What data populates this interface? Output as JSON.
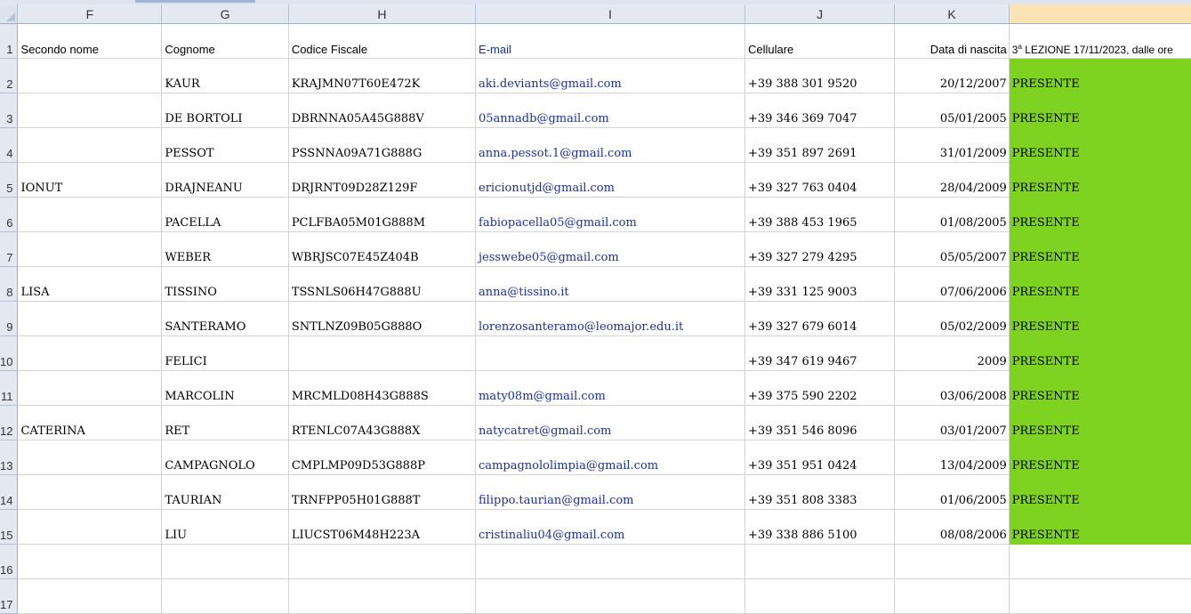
{
  "columns": [
    "F",
    "G",
    "H",
    "I",
    "J",
    "K",
    ""
  ],
  "rows": [
    {
      "num": "1",
      "nome": "Secondo nome",
      "cognome": "Cognome",
      "cf": "Codice Fiscale",
      "email": "E-mail",
      "cell": "Cellulare",
      "data": "Data di nascita",
      "presenza": ""
    },
    {
      "num": "2",
      "nome": "",
      "cognome": "KAUR",
      "cf": "KRAJMN07T60E472K",
      "email": "aki.deviants@gmail.com",
      "cell": "+39 388 301 9520",
      "data": "20/12/2007",
      "presenza": "PRESENTE"
    },
    {
      "num": "3",
      "nome": "",
      "cognome": "DE BORTOLI",
      "cf": "DBRNNA05A45G888V",
      "email": "05annadb@gmail.com",
      "cell": "+39 346 369 7047",
      "data": "05/01/2005",
      "presenza": "PRESENTE"
    },
    {
      "num": "4",
      "nome": "",
      "cognome": "PESSOT",
      "cf": "PSSNNA09A71G888G",
      "email": "anna.pessot.1@gmail.com",
      "cell": "+39 351 897 2691",
      "data": "31/01/2009",
      "presenza": "PRESENTE"
    },
    {
      "num": "5",
      "nome": "IONUT",
      "cognome": "DRAJNEANU",
      "cf": "DRJRNT09D28Z129F",
      "email": "ericionutjd@gmail.com",
      "cell": "+39 327 763 0404",
      "data": "28/04/2009",
      "presenza": "PRESENTE"
    },
    {
      "num": "6",
      "nome": "",
      "cognome": "PACELLA",
      "cf": "PCLFBA05M01G888M",
      "email": "fabiopacella05@gmail.com",
      "cell": "+39 388 453 1965",
      "data": "01/08/2005",
      "presenza": "PRESENTE"
    },
    {
      "num": "7",
      "nome": "",
      "cognome": "WEBER",
      "cf": "WBRJSC07E45Z404B",
      "email": "jesswebe05@gmail.com",
      "cell": "+39 327 279 4295",
      "data": "05/05/2007",
      "presenza": "PRESENTE"
    },
    {
      "num": "8",
      "nome": "LISA",
      "cognome": "TISSINO",
      "cf": "TSSNLS06H47G888U",
      "email": "anna@tissino.it",
      "cell": "+39 331 125 9003",
      "data": "07/06/2006",
      "presenza": "PRESENTE"
    },
    {
      "num": "9",
      "nome": "",
      "cognome": "SANTERAMO",
      "cf": "SNTLNZ09B05G888O",
      "email": "lorenzosanteramo@leomajor.edu.it",
      "cell": "+39 327 679 6014",
      "data": "05/02/2009",
      "presenza": "PRESENTE"
    },
    {
      "num": "10",
      "nome": "",
      "cognome": "FELICI",
      "cf": "",
      "email": "",
      "cell": "+39 347 619 9467",
      "data": "2009",
      "presenza": "PRESENTE"
    },
    {
      "num": "11",
      "nome": "",
      "cognome": "MARCOLIN",
      "cf": "MRCMLD08H43G888S",
      "email": "maty08m@gmail.com",
      "cell": "+39 375 590 2202",
      "data": "03/06/2008",
      "presenza": "PRESENTE"
    },
    {
      "num": "12",
      "nome": "CATERINA",
      "cognome": "RET",
      "cf": "RTENLC07A43G888X",
      "email": "natycatret@gmail.com",
      "cell": "+39 351 546 8096",
      "data": "03/01/2007",
      "presenza": "PRESENTE"
    },
    {
      "num": "13",
      "nome": "",
      "cognome": "CAMPAGNOLO",
      "cf": "CMPLMP09D53G888P",
      "email": "campagnololimpia@gmail.com",
      "cell": "+39 351 951 0424",
      "data": "13/04/2009",
      "presenza": "PRESENTE"
    },
    {
      "num": "14",
      "nome": "",
      "cognome": "TAURIAN",
      "cf": "TRNFPP05H01G888T",
      "email": "filippo.taurian@gmail.com",
      "cell": "+39 351 808 3383",
      "data": "01/06/2005",
      "presenza": "PRESENTE"
    },
    {
      "num": "15",
      "nome": "",
      "cognome": "LIU",
      "cf": "LIUCST06M48H223A",
      "email": "cristinaliu04@gmail.com",
      "cell": "+39 338 886 5100",
      "data": "08/08/2006",
      "presenza": "PRESENTE"
    },
    {
      "num": "16",
      "nome": "",
      "cognome": "",
      "cf": "",
      "email": "",
      "cell": "",
      "data": "",
      "presenza": ""
    },
    {
      "num": "17",
      "nome": "",
      "cognome": "",
      "cf": "",
      "email": "",
      "cell": "",
      "data": "",
      "presenza": ""
    }
  ],
  "lesson_header": {
    "ord": "3",
    "sup": "a",
    "rest": " LEZIONE 17/11/2023, dalle ore"
  },
  "colors": {
    "present_fill": "#7ed321",
    "email_text": "#1b2fa0",
    "header_bg": "#e3e8f1",
    "selected_col": "#fbe3b6"
  }
}
